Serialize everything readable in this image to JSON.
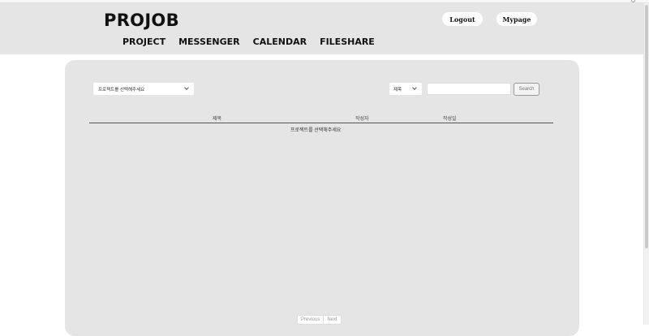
{
  "header": {
    "logo": "PROJOB",
    "nav": [
      "PROJECT",
      "MESSENGER",
      "CALENDAR",
      "FILESHARE"
    ],
    "logout_label": "Logout",
    "mypage_label": "Mypage"
  },
  "filters": {
    "project_select": "프로젝트를 선택해주세요",
    "field_select": "제목",
    "search_placeholder": "",
    "search_label": "Search"
  },
  "table": {
    "columns": [
      "제목",
      "작성자",
      "작성일"
    ],
    "empty_message": "프로젝트를 선택해주세요"
  },
  "pagination": {
    "previous": "Previous",
    "next": "Next"
  }
}
